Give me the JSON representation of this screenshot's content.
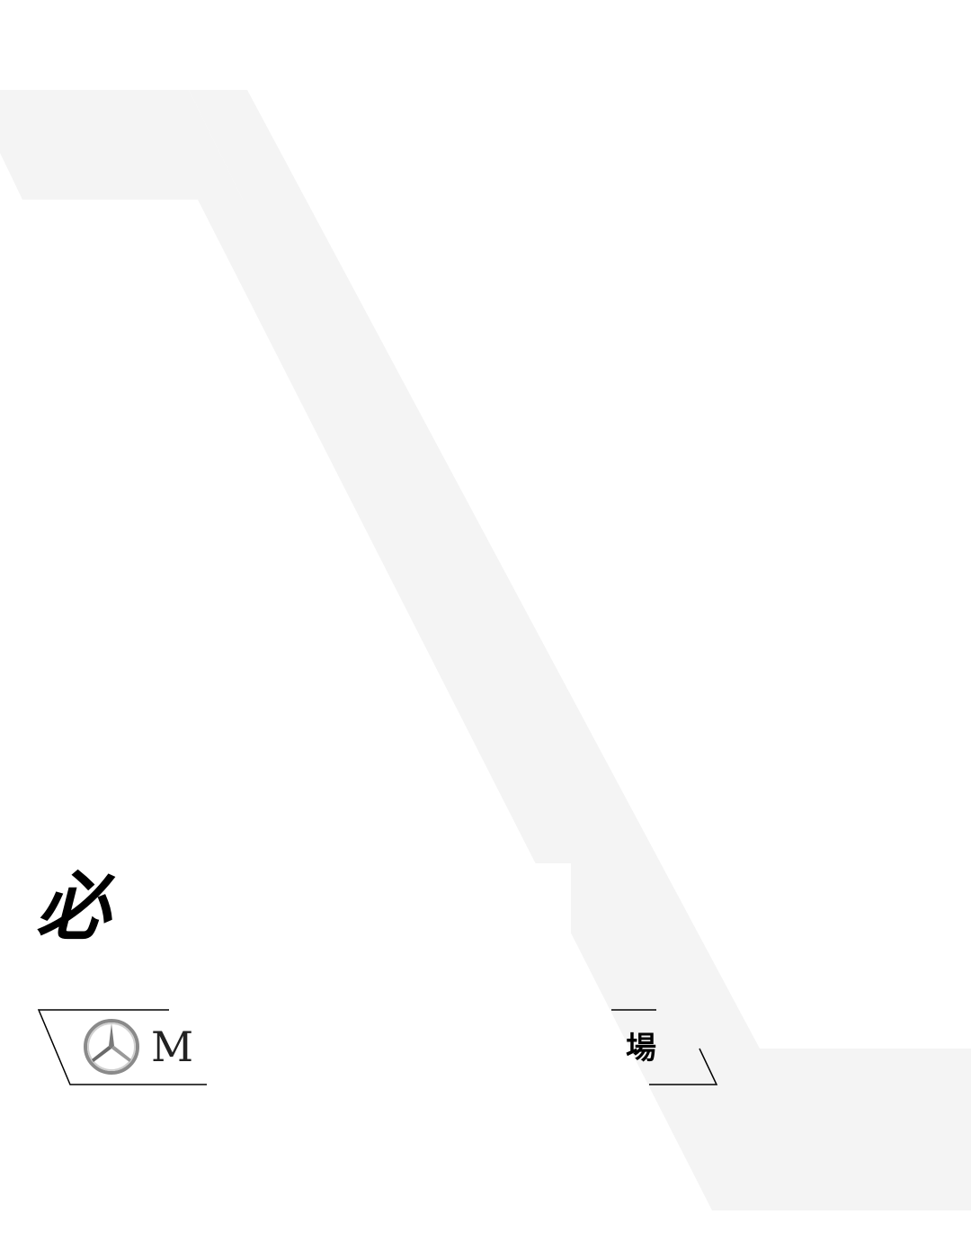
{
  "page": {
    "background": "#ffffff",
    "shape_color": "#f4f4f4",
    "text_color": "#000000"
  },
  "cover": {
    "title": "必",
    "title_tail": "",
    "brand_logo_icon": "three-pointed-star-icon",
    "brand_word": "M",
    "banner_tail": "場"
  }
}
